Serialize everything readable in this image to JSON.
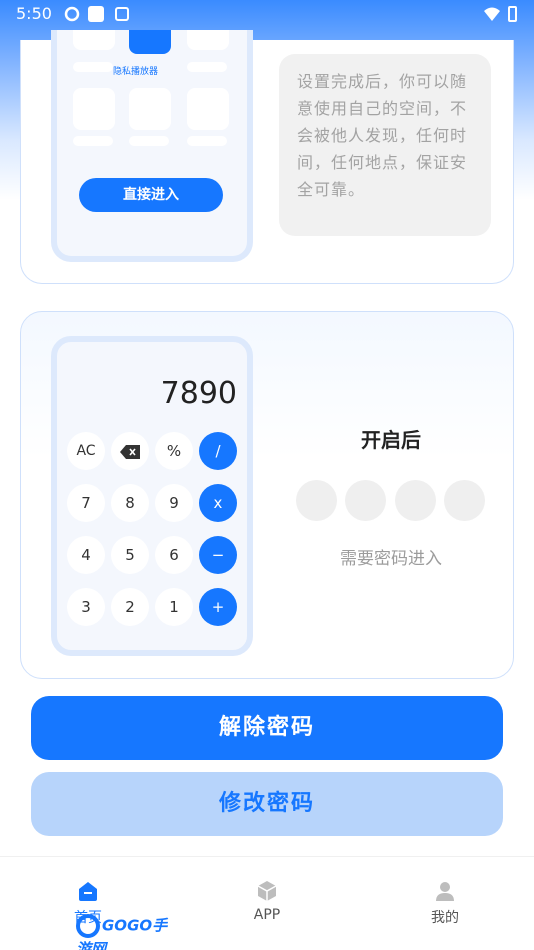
{
  "status": {
    "time": "5:50"
  },
  "card1": {
    "app_label": "隐私播放器",
    "enter_button": "直接进入",
    "description": "设置完成后，你可以随意使用自己的空间，不会被他人发现，任何时间，任何地点，保证安全可靠。"
  },
  "card2": {
    "display": "7890",
    "keys": {
      "ac": "AC",
      "percent": "%",
      "divide": "/",
      "k7": "7",
      "k8": "8",
      "k9": "9",
      "multiply": "x",
      "k4": "4",
      "k5": "5",
      "k6": "6",
      "minus": "−",
      "k3": "3",
      "k2": "2",
      "k1": "1",
      "plus": "+"
    },
    "title": "开启后",
    "subtitle": "需要密码进入"
  },
  "buttons": {
    "remove_password": "解除密码",
    "change_password": "修改密码"
  },
  "tabs": {
    "home": "首页",
    "app": "APP",
    "mine": "我的"
  },
  "watermark": "GOGO手游网",
  "colors": {
    "accent": "#1677ff",
    "accent_light": "#b7d4fb"
  }
}
